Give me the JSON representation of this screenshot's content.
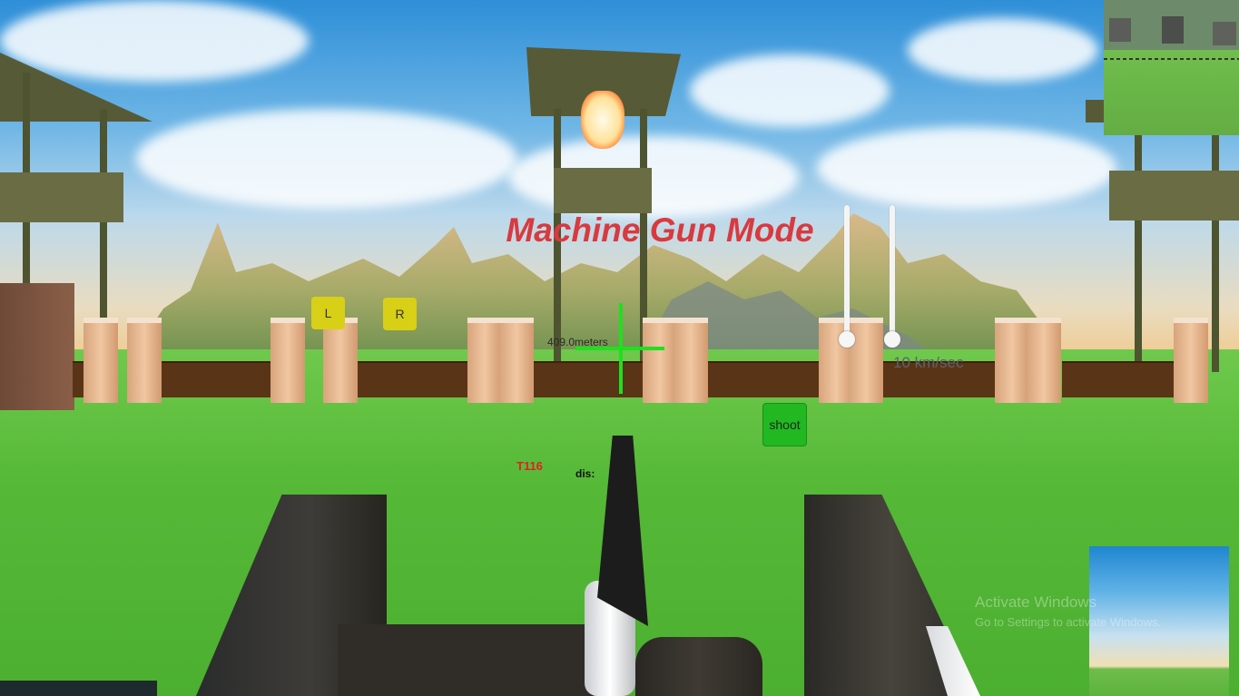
{
  "hud": {
    "mode_title": "Machine Gun Mode",
    "left_button": "L",
    "right_button": "R",
    "shoot_button": "shoot",
    "speed_readout": "10 km/sec",
    "target_distance": "409.0meters",
    "target_id": "T116",
    "distance_label": "dis:"
  },
  "overlay": {
    "activate_title": "Activate Windows",
    "activate_sub": "Go to Settings to activate Windows."
  },
  "colors": {
    "mode_title": "#d83a3f",
    "crosshair": "#1ee01e",
    "left_button": "#d8cf17",
    "right_button": "#d8cf17",
    "shoot_button": "#22b822",
    "target_id": "#e02020"
  },
  "icons": {
    "crosshair": "crosshair-icon"
  }
}
